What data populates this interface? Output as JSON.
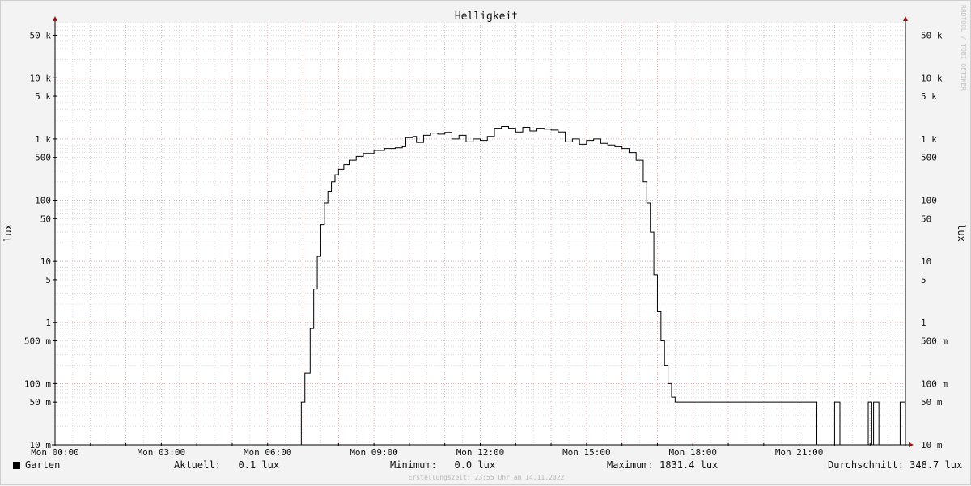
{
  "chart_data": {
    "type": "line",
    "title": "Helligkeit",
    "ylabel": "lux",
    "yscale": "log",
    "ylim": [
      0.01,
      80000
    ],
    "xlim": [
      0,
      24
    ],
    "y_ticks": [
      {
        "value": 50000,
        "label": "50 k"
      },
      {
        "value": 10000,
        "label": "10 k"
      },
      {
        "value": 5000,
        "label": "5 k"
      },
      {
        "value": 1000,
        "label": "1 k"
      },
      {
        "value": 500,
        "label": "500"
      },
      {
        "value": 100,
        "label": "100"
      },
      {
        "value": 50,
        "label": "50"
      },
      {
        "value": 10,
        "label": "10"
      },
      {
        "value": 5,
        "label": "5"
      },
      {
        "value": 1,
        "label": "1"
      },
      {
        "value": 0.5,
        "label": "500 m"
      },
      {
        "value": 0.1,
        "label": "100 m"
      },
      {
        "value": 0.05,
        "label": "50 m"
      },
      {
        "value": 0.01,
        "label": "10 m"
      }
    ],
    "x_ticks": [
      {
        "value": 0,
        "label": "Mon 00:00"
      },
      {
        "value": 3,
        "label": "Mon 03:00"
      },
      {
        "value": 6,
        "label": "Mon 06:00"
      },
      {
        "value": 9,
        "label": "Mon 09:00"
      },
      {
        "value": 12,
        "label": "Mon 12:00"
      },
      {
        "value": 15,
        "label": "Mon 15:00"
      },
      {
        "value": 18,
        "label": "Mon 18:00"
      },
      {
        "value": 21,
        "label": "Mon 21:00"
      }
    ],
    "series": [
      {
        "name": "Garten",
        "color": "#000000",
        "x": [
          0,
          6.95,
          7.05,
          7.2,
          7.3,
          7.4,
          7.5,
          7.6,
          7.7,
          7.8,
          7.9,
          8.0,
          8.15,
          8.3,
          8.5,
          8.7,
          9.0,
          9.3,
          9.6,
          9.8,
          9.9,
          10.1,
          10.2,
          10.4,
          10.6,
          10.8,
          11.0,
          11.2,
          11.4,
          11.6,
          11.8,
          12.0,
          12.2,
          12.4,
          12.6,
          12.8,
          13.0,
          13.2,
          13.4,
          13.6,
          13.8,
          14.0,
          14.2,
          14.4,
          14.6,
          14.8,
          15.0,
          15.2,
          15.4,
          15.6,
          15.8,
          16.0,
          16.2,
          16.4,
          16.6,
          16.7,
          16.8,
          16.9,
          17.0,
          17.1,
          17.2,
          17.3,
          17.4,
          17.5,
          17.6,
          17.7,
          17.8,
          18.0,
          20.0,
          21.0,
          21.5,
          21.95,
          22.0,
          22.1,
          22.15,
          22.35,
          22.4,
          22.9,
          22.95,
          23.05,
          23.1,
          23.2,
          23.25,
          23.8,
          23.85,
          24.0
        ],
        "values": [
          0.01,
          0.05,
          0.15,
          0.8,
          3.5,
          12,
          40,
          90,
          140,
          200,
          260,
          320,
          380,
          450,
          520,
          580,
          650,
          700,
          720,
          750,
          1050,
          1100,
          880,
          1150,
          1250,
          1200,
          1280,
          1000,
          1150,
          900,
          1000,
          950,
          1100,
          1500,
          1600,
          1500,
          1300,
          1550,
          1350,
          1500,
          1450,
          1400,
          1300,
          900,
          1000,
          820,
          950,
          1000,
          850,
          800,
          750,
          700,
          600,
          450,
          200,
          90,
          30,
          6,
          1.5,
          0.5,
          0.2,
          0.1,
          0.06,
          0.05,
          0.05,
          0.05,
          0.05,
          0.05,
          0.05,
          0.05,
          0.01,
          0.01,
          0.05,
          0.05,
          0.01,
          0.01,
          0.01,
          0.01,
          0.05,
          0.01,
          0.05,
          0.05,
          0.01,
          0.01,
          0.05,
          0.05
        ]
      }
    ],
    "grid": true
  },
  "legend": {
    "series_label": "Garten",
    "current": "Aktuell:   0.1 lux",
    "minimum": "Minimum:   0.0 lux",
    "maximum": "Maximum: 1831.4 lux",
    "average": "Durchschnitt: 348.7 lux"
  },
  "watermark": "RRDTOOL / TOBI OETIKER",
  "footer": "Erstellungszeit: 23:55 Uhr am 14.11.2022",
  "colors": {
    "background": "#f3f3f3",
    "canvas": "#ffffff",
    "major_grid": "#e8a0a0",
    "minor_grid": "#c8c8c8",
    "axis": "#000000",
    "arrow": "#a01010",
    "line": "#000000"
  }
}
